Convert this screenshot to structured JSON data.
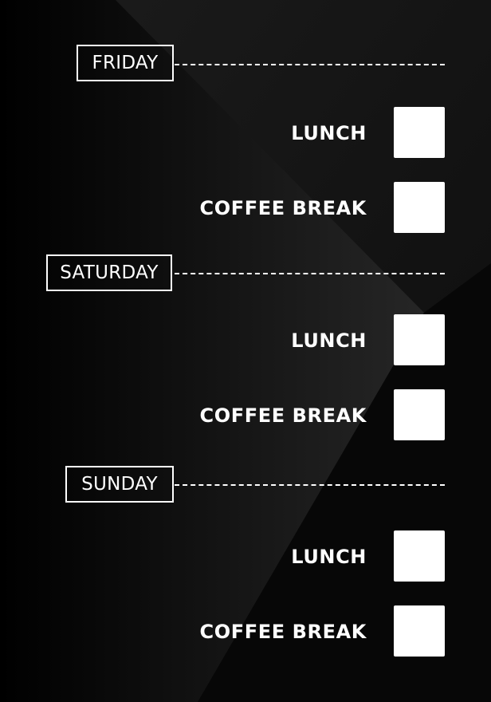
{
  "days": [
    {
      "name": "FRIDAY",
      "items": [
        {
          "label": "LUNCH",
          "checked": false
        },
        {
          "label": "COFFEE BREAK",
          "checked": false
        }
      ]
    },
    {
      "name": "SATURDAY",
      "items": [
        {
          "label": "LUNCH",
          "checked": false
        },
        {
          "label": "COFFEE BREAK",
          "checked": false
        }
      ]
    },
    {
      "name": "SUNDAY",
      "items": [
        {
          "label": "LUNCH",
          "checked": false
        },
        {
          "label": "COFFEE BREAK",
          "checked": false
        }
      ]
    }
  ],
  "colors": {
    "background": "#000000",
    "foreground": "#ffffff"
  }
}
